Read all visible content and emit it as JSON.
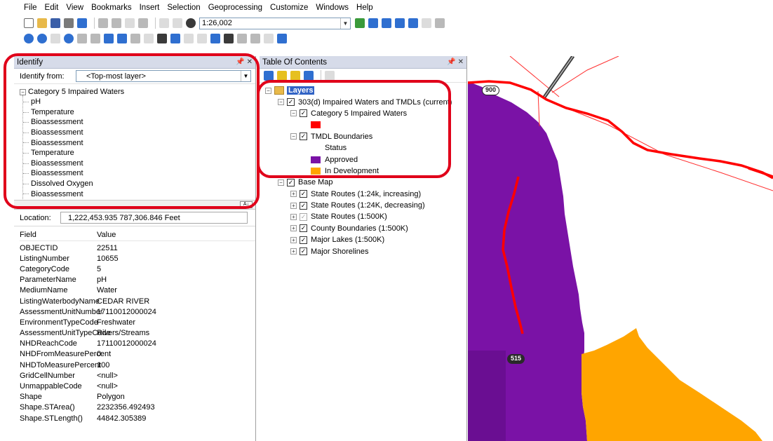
{
  "menu": [
    "File",
    "Edit",
    "View",
    "Bookmarks",
    "Insert",
    "Selection",
    "Geoprocessing",
    "Customize",
    "Windows",
    "Help"
  ],
  "toolbar": {
    "scale": "1:26,002"
  },
  "identify": {
    "title": "Identify",
    "from_label": "Identify from:",
    "from_value": "<Top-most layer>",
    "tree_root": "Category 5 Impaired Waters",
    "tree_items": [
      "pH",
      "Temperature",
      "Bioassessment",
      "Bioassessment",
      "Bioassessment",
      "Temperature",
      "Bioassessment",
      "Bioassessment",
      "Dissolved Oxygen",
      "Bioassessment"
    ],
    "location_label": "Location:",
    "location_value": "1,222,453.935  787,306.846 Feet",
    "field_header": "Field",
    "value_header": "Value",
    "attributes": [
      {
        "field": "OBJECTID",
        "value": "22511"
      },
      {
        "field": "ListingNumber",
        "value": "10655"
      },
      {
        "field": "CategoryCode",
        "value": "5"
      },
      {
        "field": "ParameterName",
        "value": "pH"
      },
      {
        "field": "MediumName",
        "value": "Water"
      },
      {
        "field": "ListingWaterbodyName",
        "value": "CEDAR RIVER"
      },
      {
        "field": "AssessmentUnitNumber",
        "value": "17110012000024"
      },
      {
        "field": "EnvironmentTypeCode",
        "value": "Freshwater"
      },
      {
        "field": "AssessmentUnitTypeCode",
        "value": "Rivers/Streams"
      },
      {
        "field": "NHDReachCode",
        "value": "17110012000024"
      },
      {
        "field": "NHDFromMeasurePercent",
        "value": "0"
      },
      {
        "field": "NHDToMeasurePercent",
        "value": "100"
      },
      {
        "field": "GridCellNumber",
        "value": "<null>"
      },
      {
        "field": "UnmappableCode",
        "value": "<null>"
      },
      {
        "field": "Shape",
        "value": "Polygon"
      },
      {
        "field": "Shape.STArea()",
        "value": "2232356.492493"
      },
      {
        "field": "Shape.STLength()",
        "value": "44842.305389"
      }
    ]
  },
  "toc": {
    "title": "Table Of Contents",
    "layers_label": "Layers",
    "group1": "303(d) Impaired Waters and TMDLs (current)",
    "category5": "Category 5 Impaired Waters",
    "tmdl": "TMDL Boundaries",
    "status": "Status",
    "approved": "Approved",
    "in_development": "In Development",
    "base_map": "Base Map",
    "base_layers": [
      "State Routes (1:24k, increasing)",
      "State Routes (1:24K, decreasing)",
      "State Routes (1:500K)",
      "County Boundaries (1:500K)",
      "Major Lakes (1:500K)",
      "Major Shorelines"
    ]
  },
  "map": {
    "shield_900": "900",
    "shield_515": "515"
  },
  "colors": {
    "category5": "#ff0000",
    "approved": "#7a12a6",
    "in_development": "#ffa500",
    "highlight": "#e0001a"
  },
  "icons": [
    "new-doc-icon",
    "open-folder-icon",
    "save-icon",
    "print-icon",
    "add-data-icon",
    "identify-icon",
    "find-icon",
    "layers-icon",
    "pin-icon",
    "close-icon"
  ]
}
